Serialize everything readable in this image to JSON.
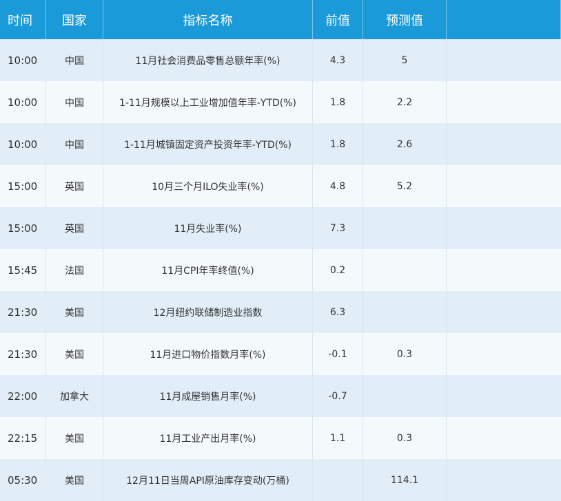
{
  "headers": {
    "time": "时间",
    "country": "国家",
    "indicator": "指标名称",
    "previous": "前值",
    "forecast": "预测值",
    "extra": ""
  },
  "rows": [
    {
      "time": "10:00",
      "country": "中国",
      "indicator": "11月社会消费品零售总额年率(%)",
      "previous": "4.3",
      "forecast": "5"
    },
    {
      "time": "10:00",
      "country": "中国",
      "indicator": "1-11月规模以上工业增加值年率-YTD(%)",
      "previous": "1.8",
      "forecast": "2.2"
    },
    {
      "time": "10:00",
      "country": "中国",
      "indicator": "1-11月城镇固定资产投资年率-YTD(%)",
      "previous": "1.8",
      "forecast": "2.6"
    },
    {
      "time": "15:00",
      "country": "英国",
      "indicator": "10月三个月ILO失业率(%)",
      "previous": "4.8",
      "forecast": "5.2"
    },
    {
      "time": "15:00",
      "country": "英国",
      "indicator": "11月失业率(%)",
      "previous": "7.3",
      "forecast": ""
    },
    {
      "time": "15:45",
      "country": "法国",
      "indicator": "11月CPI年率终值(%)",
      "previous": "0.2",
      "forecast": ""
    },
    {
      "time": "21:30",
      "country": "美国",
      "indicator": "12月纽约联储制造业指数",
      "previous": "6.3",
      "forecast": ""
    },
    {
      "time": "21:30",
      "country": "美国",
      "indicator": "11月进口物价指数月率(%)",
      "previous": "-0.1",
      "forecast": "0.3"
    },
    {
      "time": "22:00",
      "country": "加拿大",
      "indicator": "11月成屋销售月率(%)",
      "previous": "-0.7",
      "forecast": ""
    },
    {
      "time": "22:15",
      "country": "美国",
      "indicator": "11月工业产出月率(%)",
      "previous": "1.1",
      "forecast": "0.3"
    },
    {
      "time": "05:30",
      "country": "美国",
      "indicator": "12月11日当周API原油库存变动(万桶)",
      "previous": "",
      "forecast": "114.1"
    }
  ]
}
